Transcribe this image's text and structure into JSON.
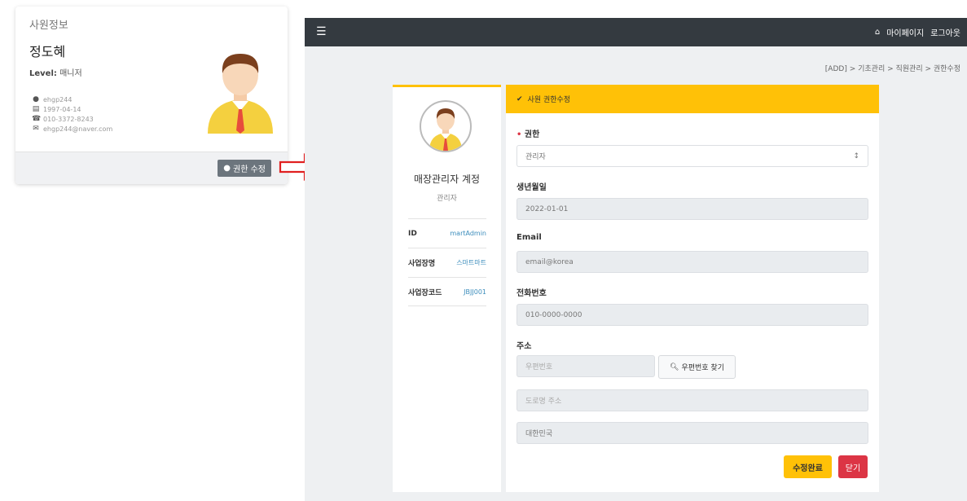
{
  "employee_card": {
    "title": "사원정보",
    "name": "정도혜",
    "level_label": "Level:",
    "level_value": "매니저",
    "info": [
      {
        "icon": "user-icon",
        "text": "ehgp244"
      },
      {
        "icon": "birthday-cake-icon",
        "text": "1997-04-14"
      },
      {
        "icon": "phone-icon",
        "text": "010-3372-8243"
      },
      {
        "icon": "envelope-icon",
        "text": "ehgp244@naver.com"
      }
    ],
    "edit_button": "권한 수정"
  },
  "topbar": {
    "mypage": "마이페이지",
    "logout": "로그아웃"
  },
  "breadcrumb": "[ADD] > 기초관리 > 직원관리 > 권한수정",
  "profile": {
    "title": "매장관리자 계정",
    "role": "관리자",
    "rows": [
      {
        "key": "ID",
        "value": "martAdmin"
      },
      {
        "key": "사업장명",
        "value": "스마트마트"
      },
      {
        "key": "사업장코드",
        "value": "JBJJ001"
      }
    ]
  },
  "form": {
    "header": "사원 권한수정",
    "authority_label": "권한",
    "authority_value": "관리자",
    "birth_label": "생년월일",
    "birth_value": "2022-01-01",
    "email_label": "Email",
    "email_value": "email@korea",
    "phone_label": "전화번호",
    "phone_value": "010-0000-0000",
    "address_label": "주소",
    "zipcode_placeholder": "우편번호",
    "zip_button": "우편번호 찾기",
    "road_placeholder": "도로명 주소",
    "country_value": "대한민국",
    "save_button": "수정완료",
    "close_button": "닫기"
  },
  "colors": {
    "accent": "#ffc107",
    "topbar": "#343a40",
    "danger": "#dc3545",
    "link": "#3c8dbc"
  }
}
